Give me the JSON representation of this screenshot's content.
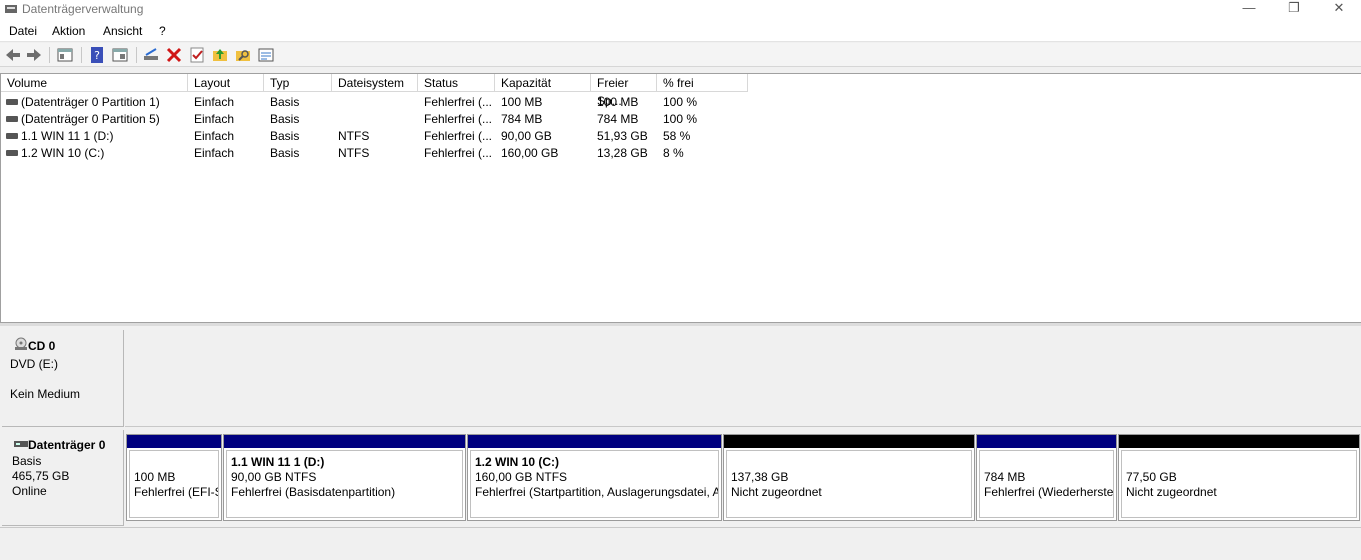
{
  "window": {
    "title": "Datenträgerverwaltung",
    "minimize": "—",
    "maximize": "❐",
    "close": "✕"
  },
  "menu": [
    "Datei",
    "Aktion",
    "Ansicht",
    "?"
  ],
  "columns": [
    "Volume",
    "Layout",
    "Typ",
    "Dateisystem",
    "Status",
    "Kapazität",
    "Freier Sp...",
    "% frei"
  ],
  "volumes": [
    [
      "(Datenträger 0 Partition 1)",
      "Einfach",
      "Basis",
      "",
      "Fehlerfrei (...",
      "100 MB",
      "100 MB",
      "100 %"
    ],
    [
      "(Datenträger 0 Partition 5)",
      "Einfach",
      "Basis",
      "",
      "Fehlerfrei (...",
      "784 MB",
      "784 MB",
      "100 %"
    ],
    [
      "1.1 WIN 11 1 (D:)",
      "Einfach",
      "Basis",
      "NTFS",
      "Fehlerfrei (...",
      "90,00 GB",
      "51,93 GB",
      "58 %"
    ],
    [
      "1.2 WIN 10 (C:)",
      "Einfach",
      "Basis",
      "NTFS",
      "Fehlerfrei (...",
      "160,00 GB",
      "13,28 GB",
      "8 %"
    ]
  ],
  "cd": {
    "name": "CD 0",
    "line1": "DVD (E:)",
    "line2": "Kein Medium"
  },
  "disk0": {
    "name": "Datenträger 0",
    "type": "Basis",
    "size": "465,75 GB",
    "state": "Online"
  },
  "partitions": [
    {
      "title": "",
      "size": "100 MB",
      "status": "Fehlerfrei (EFI-S"
    },
    {
      "title": "1.1 WIN 11 1  (D:)",
      "size": "90,00 GB NTFS",
      "status": "Fehlerfrei (Basisdatenpartition)"
    },
    {
      "title": "1.2 WIN 10  (C:)",
      "size": "160,00 GB NTFS",
      "status": "Fehlerfrei (Startpartition, Auslagerungsdatei, A"
    },
    {
      "title": "",
      "size": "137,38 GB",
      "status": "Nicht zugeordnet"
    },
    {
      "title": "",
      "size": "784 MB",
      "status": "Fehlerfrei (Wiederherste"
    },
    {
      "title": "",
      "size": "77,50 GB",
      "status": "Nicht zugeordnet"
    }
  ],
  "colors": {
    "primary_bar": "#00007f",
    "unallocated_bar": "#000000"
  }
}
